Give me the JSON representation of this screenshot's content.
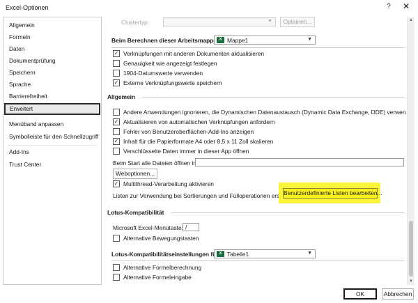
{
  "window": {
    "title": "Excel-Optionen",
    "help": "?",
    "close": "✕"
  },
  "sidebar": {
    "items": [
      {
        "label": "Allgemein"
      },
      {
        "label": "Formeln"
      },
      {
        "label": "Daten"
      },
      {
        "label": "Dokumentprüfung"
      },
      {
        "label": "Speichern"
      },
      {
        "label": "Sprache"
      },
      {
        "label": "Barrierefreiheit"
      },
      {
        "label": "Erweitert",
        "selected": true
      },
      {
        "label": "Menüband anpassen"
      },
      {
        "label": "Symbolleiste für den Schnellzugriff"
      },
      {
        "label": "Add-Ins"
      },
      {
        "label": "Trust Center"
      }
    ]
  },
  "top": {
    "clustertyp_label": "Clustertyp:",
    "optionen_button": "Optionen..."
  },
  "berechnen": {
    "label": "Beim Berechnen dieser Arbeitsmappe:",
    "workbook": "Mappe1",
    "options": [
      {
        "label": "Verknüpfungen mit anderen Dokumenten aktualisieren",
        "checked": true
      },
      {
        "label": "Genauigkeit wie angezeigt festlegen",
        "checked": false
      },
      {
        "label": "1904-Datumswerte verwenden",
        "checked": false
      },
      {
        "label": "Externe Verknüpfungswerte speichern",
        "checked": true
      }
    ]
  },
  "allgemein": {
    "title": "Allgemein",
    "options": [
      {
        "label": "Andere Anwendungen ignorieren, die Dynamischen Datenaustausch (Dynamic Data Exchange, DDE) verwenden",
        "checked": false
      },
      {
        "label": "Aktualisieren von automatischen Verknüpfungen anfordern",
        "checked": true
      },
      {
        "label": "Fehler von Benutzeroberflächen-Add-Ins anzeigen",
        "checked": false
      },
      {
        "label": "Inhalt für die Papierformate A4 oder 8,5 x 11 Zoll skalieren",
        "checked": true
      },
      {
        "label": "Verschlüsselte Daten immer in dieser App öffnen",
        "checked": false
      }
    ],
    "startup_label": "Beim Start alle Dateien öffnen in:",
    "startup_value": "",
    "weboptionen_button": "Weboptionen...",
    "multithread": {
      "label": "Multithread-Verarbeitung aktivieren",
      "checked": true
    },
    "listen_label": "Listen zur Verwendung bei Sortierungen und Fülloperationen erstellen:",
    "listen_button": "Benutzerdefinierte Listen bearbeiten..."
  },
  "lotus": {
    "title": "Lotus-Kompatibilität",
    "menutaste_label": "Microsoft Excel-Menütaste:",
    "menutaste_value": "/",
    "alt_bewegung": {
      "label": "Alternative Bewegungstasten",
      "checked": false
    }
  },
  "lotus_settings": {
    "label": "Lotus-Kompatibilitätseinstellungen für:",
    "sheet": "Tabelle1",
    "options": [
      {
        "label": "Alternative Formelberechnung",
        "checked": false
      },
      {
        "label": "Alternative Formeleingabe",
        "checked": false
      }
    ]
  },
  "footer": {
    "ok": "OK",
    "cancel": "Abbrechen"
  },
  "colors": {
    "highlight": "#fbf53a",
    "excel_green": "#1d6f42"
  }
}
